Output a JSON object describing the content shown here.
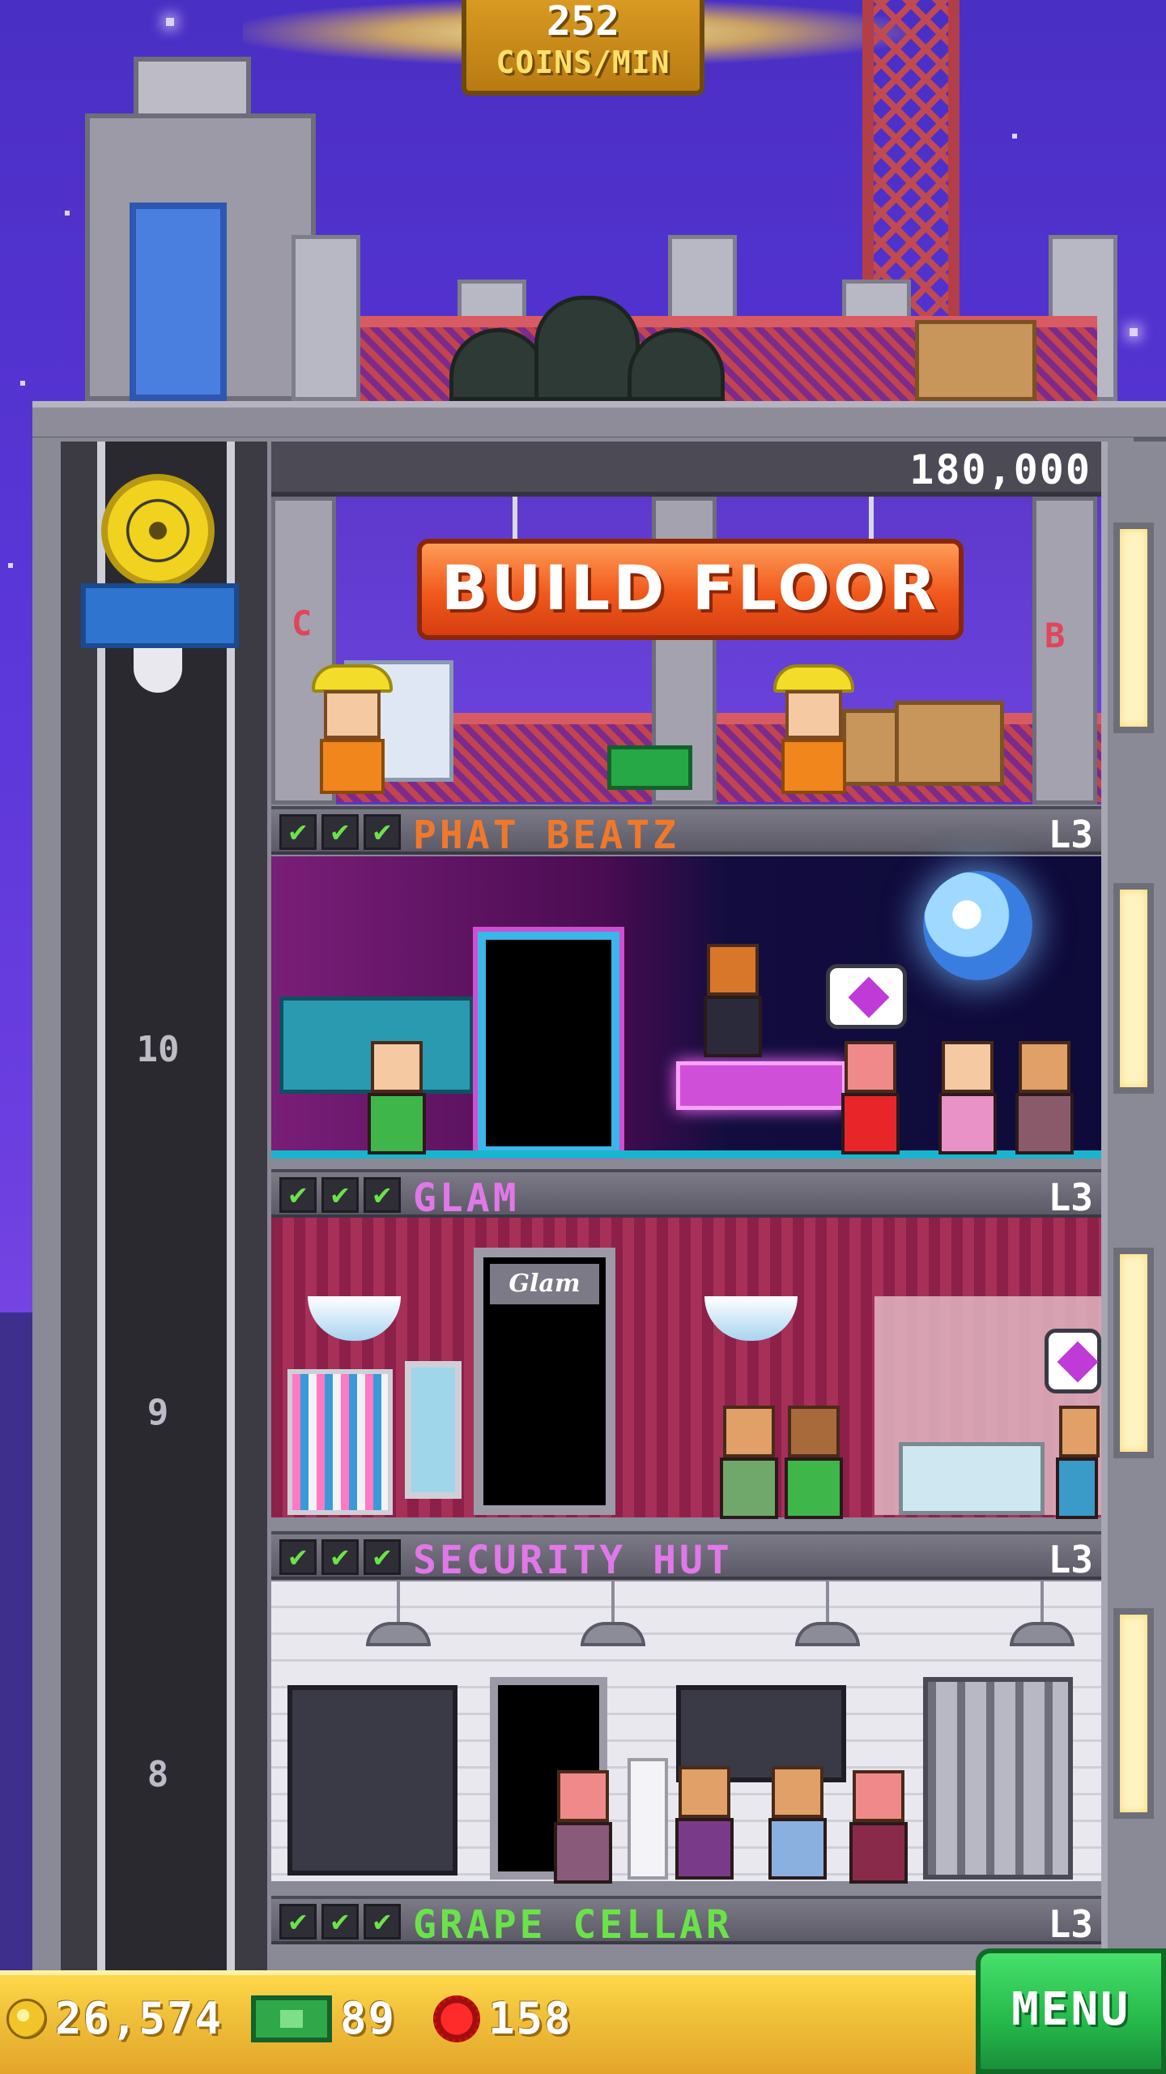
{
  "hud": {
    "coins_per_min": "252",
    "coins_per_min_label": "COINS/MIN"
  },
  "construction": {
    "cost": "180,000",
    "button_label": "BUILD FLOOR",
    "left_letter": "C",
    "right_letter": "B"
  },
  "elevator": {
    "floor_numbers": [
      "10",
      "9",
      "8"
    ]
  },
  "floors": [
    {
      "name": "PHAT BEATZ",
      "level": "L3",
      "name_color": "#f0782a",
      "stocked": 3
    },
    {
      "name": "GLAM",
      "level": "L3",
      "name_color": "#e078e8",
      "stocked": 3
    },
    {
      "name": "SECURITY HUT",
      "level": "L3",
      "name_color": "#e078e8",
      "stocked": 3
    },
    {
      "name": "GRAPE CELLAR",
      "level": "L3",
      "name_color": "#6ae34a",
      "stocked": 3
    }
  ],
  "glam_sign": "Glam",
  "checkmark_glyph": "✔",
  "bottom_bar": {
    "coins": "26,574",
    "tower_bux": "89",
    "gems": "158",
    "menu_label": "MENU"
  },
  "icons": {
    "coin": "coin-icon",
    "bux": "tower-bux-icon",
    "gem": "gem-icon",
    "elevator": "elevator-wheel-icon"
  }
}
